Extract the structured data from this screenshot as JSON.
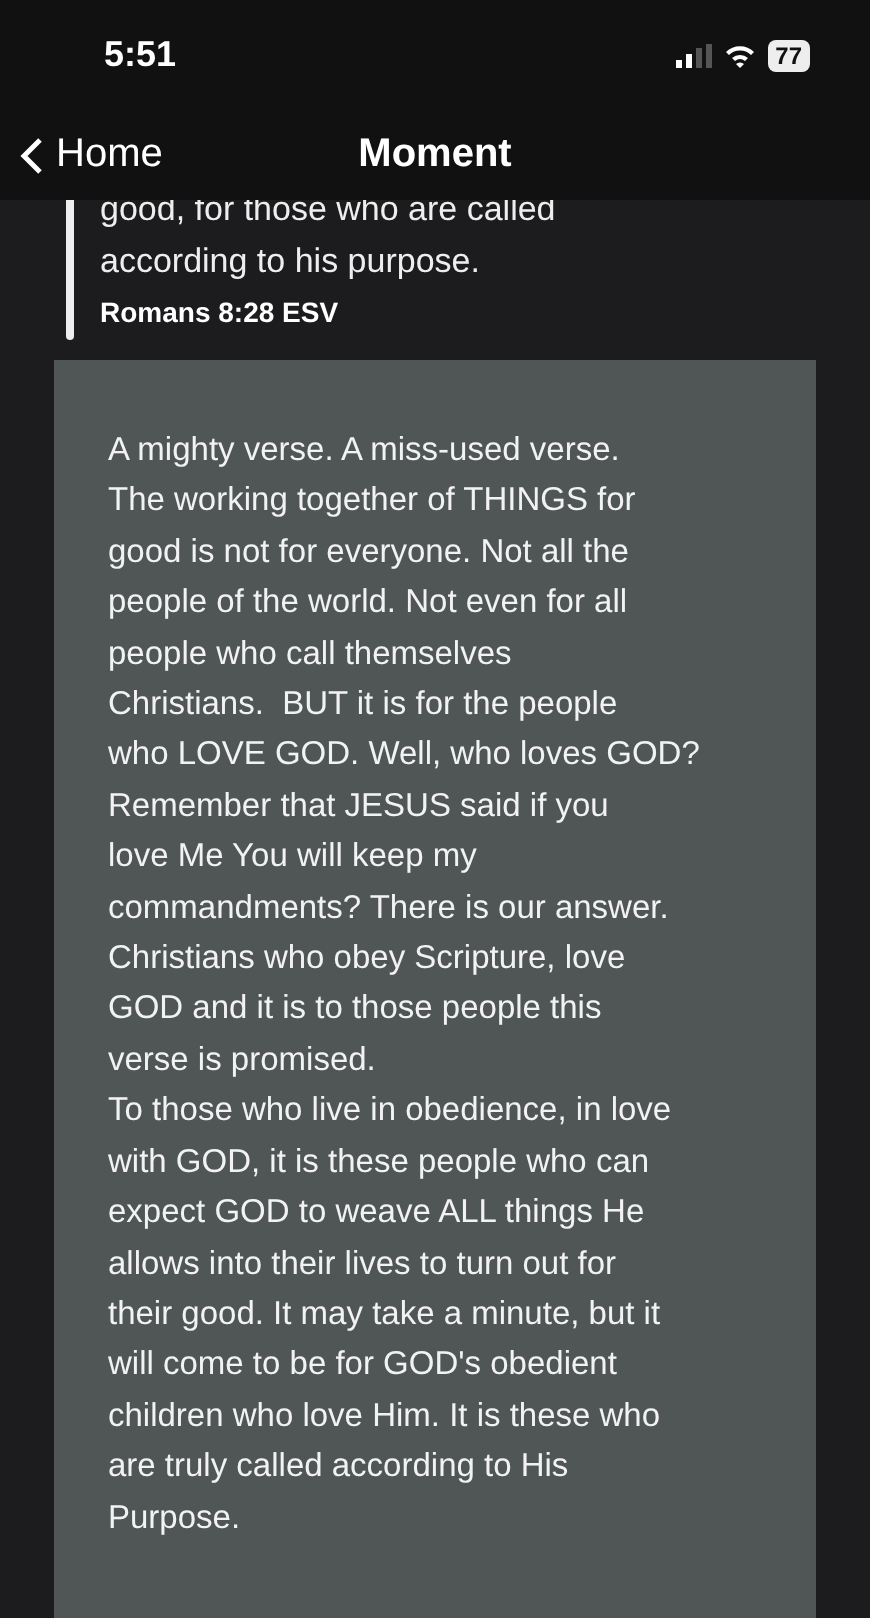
{
  "status_bar": {
    "time": "5:51",
    "battery": "77"
  },
  "nav": {
    "back_label": "Home",
    "title": "Moment"
  },
  "verse": {
    "text": "good, for those who are called\naccording to his purpose.",
    "reference": "Romans 8:28 ESV"
  },
  "note": {
    "paragraphs": [
      "A mighty verse. A miss-used verse.\nThe working together of THINGS for\ngood is not for everyone. Not all the\npeople of the world. Not even for all\npeople who call themselves\nChristians.  BUT it is for the people\nwho LOVE GOD. Well, who loves GOD?\nRemember that JESUS said if you\nlove Me You will keep my\ncommandments? There is our answer.\nChristians who obey Scripture, love\nGOD and it is to those people this\nverse is promised.",
      "To those who live in obedience, in love\nwith GOD, it is these people who can\nexpect GOD to weave ALL things He\nallows into their lives to turn out for\ntheir good. It may take a minute, but it\nwill come to be for GOD's obedient\nchildren who love Him. It is these who\nare truly called according to His\nPurpose."
    ]
  }
}
